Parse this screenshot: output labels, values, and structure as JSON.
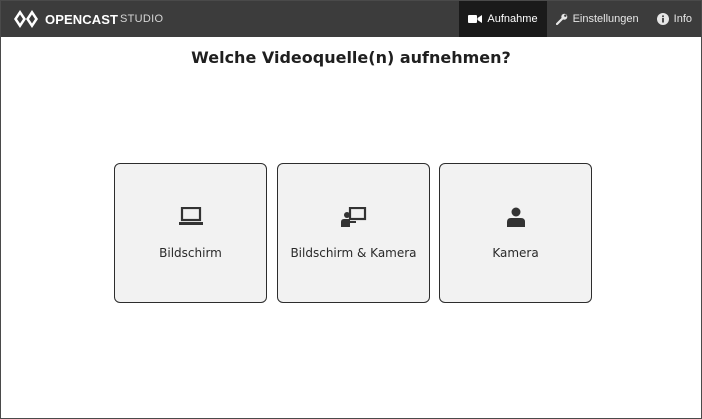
{
  "app": {
    "brand": "OPENCAST",
    "brand_sub": "STUDIO"
  },
  "nav": {
    "items": [
      {
        "label": "Aufnahme",
        "icon": "video-camera-icon",
        "active": true
      },
      {
        "label": "Einstellungen",
        "icon": "wrench-icon",
        "active": false
      },
      {
        "label": "Info",
        "icon": "info-circle-icon",
        "active": false
      }
    ]
  },
  "main": {
    "heading": "Welche Videoquelle(n) aufnehmen?",
    "options": [
      {
        "label": "Bildschirm",
        "icon": "monitor-icon"
      },
      {
        "label": "Bildschirm & Kamera",
        "icon": "screen-and-presenter-icon"
      },
      {
        "label": "Kamera",
        "icon": "user-icon"
      }
    ]
  },
  "colors": {
    "topbar": "#3c3c3c",
    "nav_active": "#1a1a1a",
    "card_bg": "#f2f2f2",
    "card_border": "#2d2d2d",
    "icon": "#333333"
  }
}
